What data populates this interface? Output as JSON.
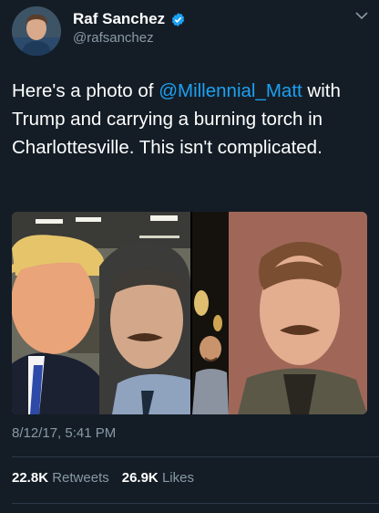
{
  "user": {
    "display_name": "Raf Sanchez",
    "handle": "@rafsanchez",
    "verified": true
  },
  "tweet": {
    "text_before": "Here's a photo of ",
    "mention": "@Millennial_Matt",
    "text_after": " with Trump and carrying a burning torch in Charlottesville. This isn't complicated.",
    "timestamp": "8/12/17, 5:41 PM"
  },
  "stats": {
    "retweets_count": "22.8K",
    "retweets_label": "Retweets",
    "likes_count": "26.9K",
    "likes_label": "Likes"
  },
  "colors": {
    "background": "#141d26",
    "text": "#ffffff",
    "secondary": "#8899a6",
    "link": "#1da1f2",
    "verified": "#1da1f2"
  },
  "icons": [
    "verified-badge-icon",
    "chevron-down-icon"
  ]
}
